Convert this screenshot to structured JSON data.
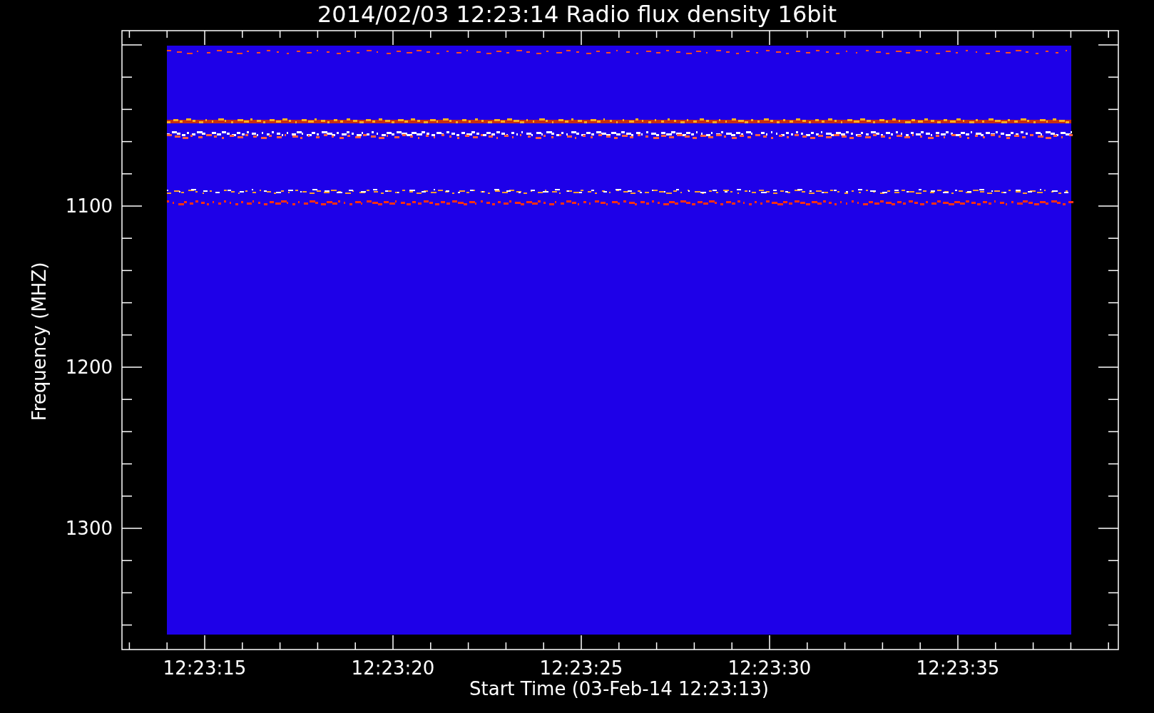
{
  "title": "2014/02/03 12:23:14 Radio flux density 16bit",
  "y_axis": {
    "label": "Frequency (MHZ)",
    "tick_labels": [
      "1100",
      "1200",
      "1300"
    ]
  },
  "x_axis": {
    "label": "Start Time (03-Feb-14 12:23:13)",
    "tick_labels": [
      "12:23:15",
      "12:23:20",
      "12:23:25",
      "12:23:30",
      "12:23:35"
    ]
  }
}
